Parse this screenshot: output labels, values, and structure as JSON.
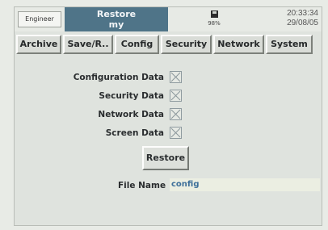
{
  "header": {
    "user": "Engineer",
    "title_line1": "Restore",
    "title_line2": "my",
    "disk_icon": "floppy-disk-icon",
    "disk_usage": "98%",
    "time": "20:33:34",
    "date": "29/08/05"
  },
  "tabs": [
    {
      "label": "Archive"
    },
    {
      "label": "Save/R.."
    },
    {
      "label": "Config"
    },
    {
      "label": "Security"
    },
    {
      "label": "Network"
    },
    {
      "label": "System"
    }
  ],
  "options": [
    {
      "label": "Configuration Data",
      "checked": true
    },
    {
      "label": "Security Data",
      "checked": true
    },
    {
      "label": "Network Data",
      "checked": true
    },
    {
      "label": "Screen Data",
      "checked": true
    }
  ],
  "restore_button": "Restore",
  "file_name": {
    "label": "File Name",
    "value": "config"
  },
  "colors": {
    "title_bg": "#4f7488",
    "screen_bg": "#dfe3de",
    "input_bg": "#ebeee2",
    "input_text": "#3d6f9a"
  }
}
